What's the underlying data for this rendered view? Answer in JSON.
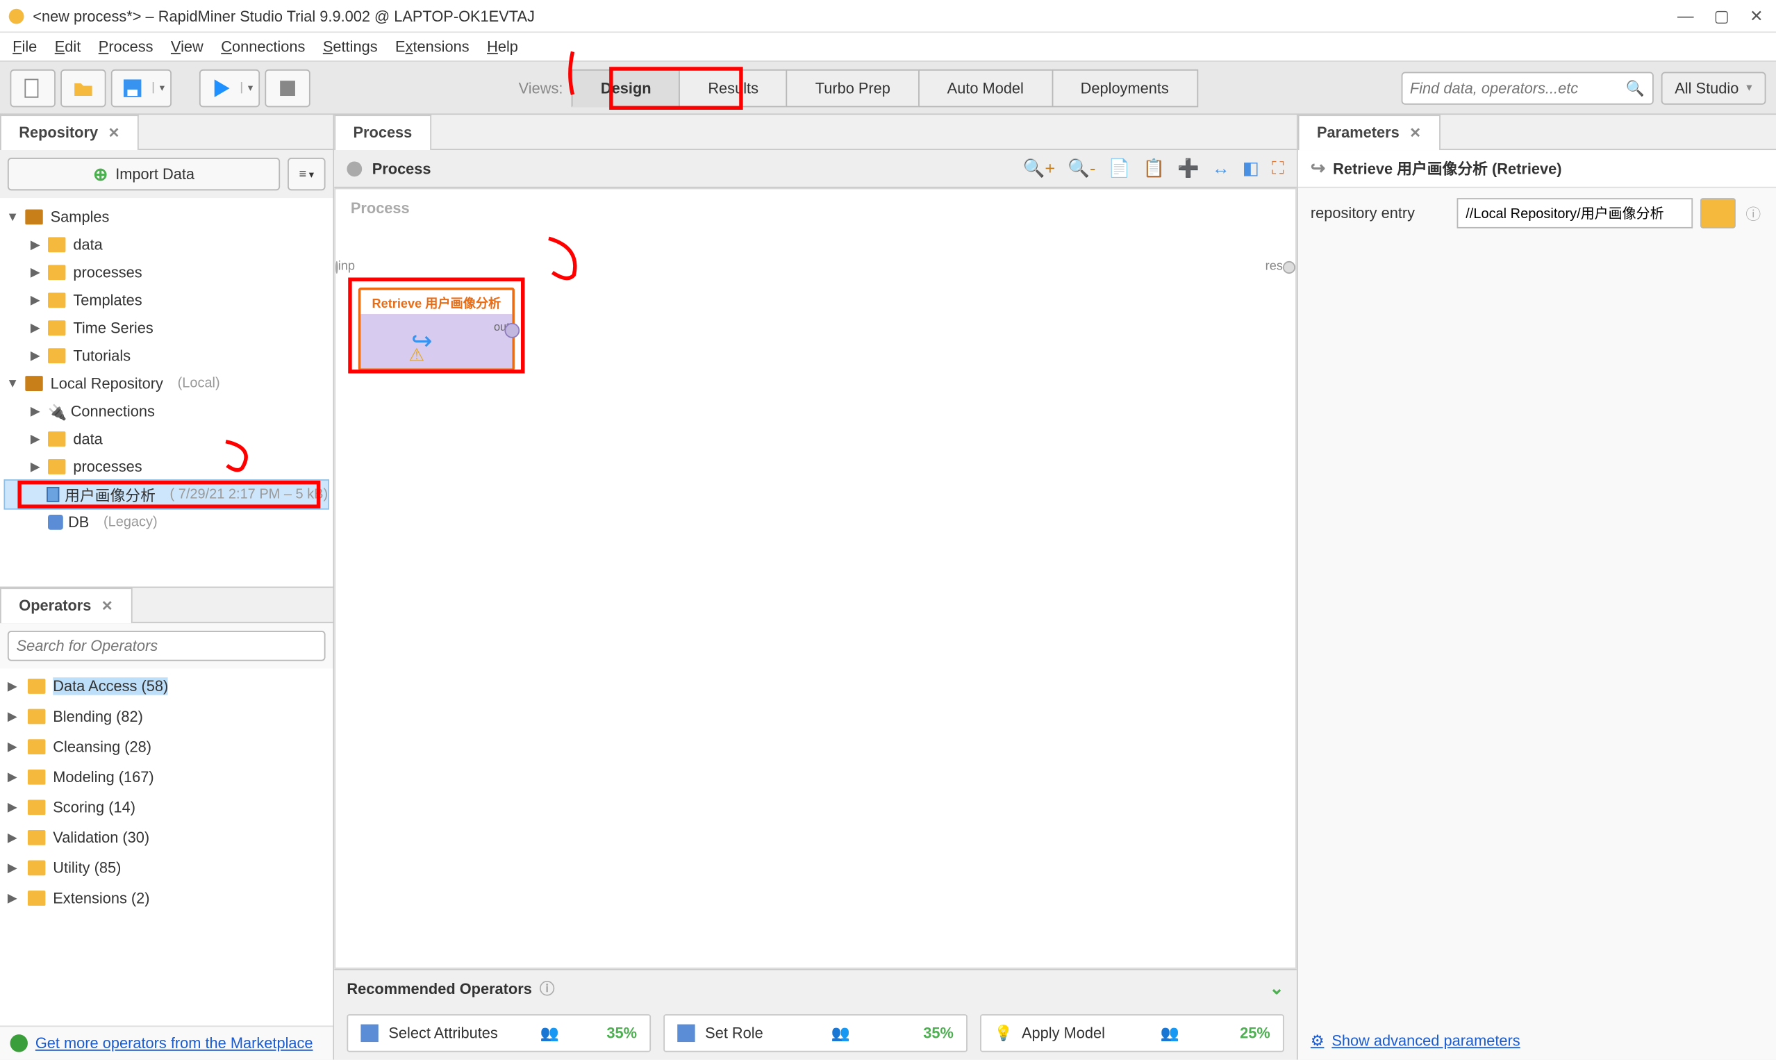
{
  "titlebar": {
    "title": "<new process*> – RapidMiner Studio Trial 9.9.002 @ LAPTOP-OK1EVTAJ"
  },
  "menubar": [
    "File",
    "Edit",
    "Process",
    "View",
    "Connections",
    "Settings",
    "Extensions",
    "Help"
  ],
  "views_label": "Views:",
  "views": [
    "Design",
    "Results",
    "Turbo Prep",
    "Auto Model",
    "Deployments"
  ],
  "active_view": "Design",
  "search_placeholder": "Find data, operators...etc",
  "allstudio_label": "All Studio",
  "repo_panel": {
    "title": "Repository",
    "import_label": "Import Data",
    "tree": {
      "samples": "Samples",
      "data": "data",
      "processes": "processes",
      "templates": "Templates",
      "timeseries": "Time Series",
      "tutorials": "Tutorials",
      "local_repo": "Local Repository",
      "local_repo_meta": "(Local)",
      "connections": "Connections",
      "local_data": "data",
      "local_processes": "processes",
      "selected_item": "用户画像分析",
      "selected_meta": "( 7/29/21 2:17 PM – 5 kB)",
      "db": "DB",
      "db_meta": "(Legacy)"
    }
  },
  "operators_panel": {
    "title": "Operators",
    "search_placeholder": "Search for Operators",
    "items": [
      "Data Access (58)",
      "Blending (82)",
      "Cleansing (28)",
      "Modeling (167)",
      "Scoring (14)",
      "Validation (30)",
      "Utility (85)",
      "Extensions (2)"
    ],
    "market_link": "Get more operators from the Marketplace"
  },
  "process_panel": {
    "tab": "Process",
    "breadcrumb": "Process",
    "canvas_label": "Process",
    "port_inp": "inp",
    "port_res": "res",
    "operator_title": "Retrieve 用户画像分析",
    "operator_out": "out"
  },
  "recommended": {
    "title": "Recommended Operators",
    "ops": [
      {
        "name": "Select Attributes",
        "pct": "35%"
      },
      {
        "name": "Set Role",
        "pct": "35%"
      },
      {
        "name": "Apply Model",
        "pct": "25%"
      }
    ]
  },
  "parameters": {
    "title": "Parameters",
    "operator_label": "Retrieve 用户画像分析 (Retrieve)",
    "row_label": "repository entry",
    "row_value": "//Local Repository/用户画像分析",
    "adv_link": "Show advanced parameters"
  }
}
